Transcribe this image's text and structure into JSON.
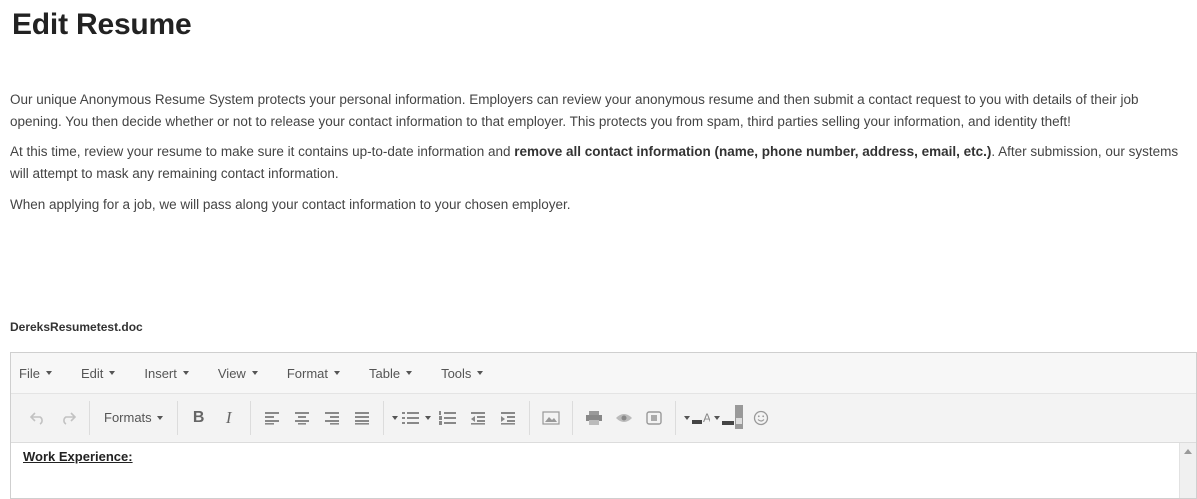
{
  "page": {
    "title": "Edit Resume",
    "intro": {
      "p1": "Our unique Anonymous Resume System protects your personal information. Employers can review your anonymous resume and then submit a contact request to you with details of their job opening. You then decide whether or not to release your contact information to that employer. This protects you from spam, third parties selling your information, and identity theft!",
      "p2_lead": "At this time, review your resume to make sure it contains up-to-date information and ",
      "p2_bold": "remove all contact information (name, phone number, address, email, etc.)",
      "p2_tail": ". After submission, our systems will attempt to mask any remaining contact information.",
      "p3": "When applying for a job, we will pass along your contact information to your chosen employer."
    },
    "filename": "DereksResumetest.doc"
  },
  "editor": {
    "menu": [
      "File",
      "Edit",
      "Insert",
      "View",
      "Format",
      "Table",
      "Tools"
    ],
    "formats_label": "Formats",
    "toolbar_icons": [
      "undo-icon",
      "redo-icon",
      "bold-icon",
      "italic-icon",
      "align-left-icon",
      "align-center-icon",
      "align-right-icon",
      "align-justify-icon",
      "bullet-list-icon",
      "numbered-list-icon",
      "outdent-icon",
      "indent-icon",
      "image-icon",
      "print-icon",
      "preview-icon",
      "media-icon",
      "text-color-icon",
      "background-color-icon",
      "emoticon-icon"
    ],
    "content_heading": "Work Experience:"
  }
}
